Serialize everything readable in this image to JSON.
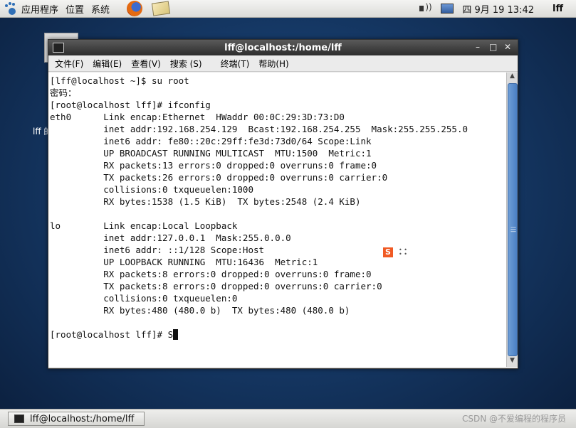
{
  "top_panel": {
    "menu": [
      "应用程序",
      "位置",
      "系统"
    ],
    "clock": "四 9月 19 13:42",
    "username": "lff"
  },
  "desktop": {
    "icon_label": "lff 的"
  },
  "window": {
    "title": "lff@localhost:/home/lff",
    "controls": {
      "minimize": "–",
      "maximize": "□",
      "close": "✕"
    },
    "menu": [
      "文件(F)",
      "编辑(E)",
      "查看(V)",
      "搜索 (S)",
      "终端(T)",
      "帮助(H)"
    ]
  },
  "terminal": {
    "lines": [
      "[lff@localhost ~]$ su root",
      "密码：",
      "[root@localhost lff]# ifconfig",
      "eth0      Link encap:Ethernet  HWaddr 00:0C:29:3D:73:D0",
      "          inet addr:192.168.254.129  Bcast:192.168.254.255  Mask:255.255.255.0",
      "          inet6 addr: fe80::20c:29ff:fe3d:73d0/64 Scope:Link",
      "          UP BROADCAST RUNNING MULTICAST  MTU:1500  Metric:1",
      "          RX packets:13 errors:0 dropped:0 overruns:0 frame:0",
      "          TX packets:26 errors:0 dropped:0 overruns:0 carrier:0",
      "          collisions:0 txqueuelen:1000",
      "          RX bytes:1538 (1.5 KiB)  TX bytes:2548 (2.4 KiB)",
      "",
      "lo        Link encap:Local Loopback",
      "          inet addr:127.0.0.1  Mask:255.0.0.0",
      "          inet6 addr: ::1/128 Scope:Host",
      "          UP LOOPBACK RUNNING  MTU:16436  Metric:1",
      "          RX packets:8 errors:0 dropped:0 overruns:0 frame:0",
      "          TX packets:8 errors:0 dropped:0 overruns:0 carrier:0",
      "          collisions:0 txqueuelen:0",
      "          RX bytes:480 (480.0 b)  TX bytes:480 (480.0 b)",
      "",
      "[root@localhost lff]# S"
    ]
  },
  "ime": {
    "logo": "S"
  },
  "taskbar": {
    "task_label": "lff@localhost:/home/lff"
  },
  "watermark": "CSDN @不爱编程的程序员",
  "colors": {
    "scroll_thumb": "#4a7fc3",
    "ime_logo": "#f05a24"
  }
}
